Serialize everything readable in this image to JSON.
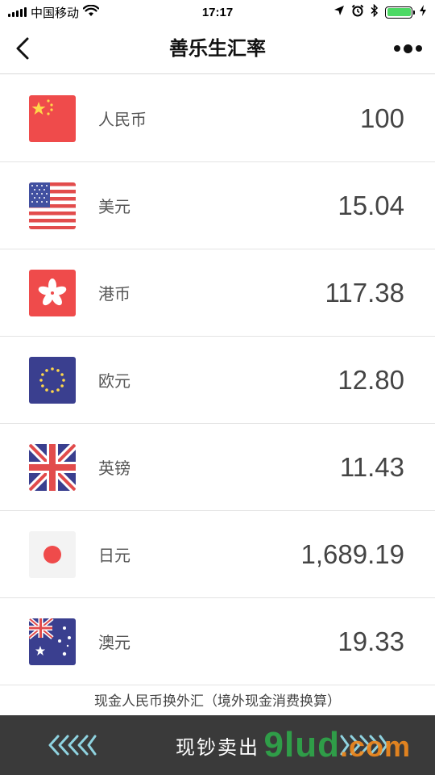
{
  "status_bar": {
    "carrier": "中国移动",
    "time": "17:17",
    "battery_color": "#4cd964",
    "icons": [
      "signal-icon",
      "wifi-icon",
      "location-icon",
      "alarm-icon",
      "bluetooth-icon",
      "battery-icon",
      "charging-icon"
    ]
  },
  "nav": {
    "title": "善乐生汇率",
    "back_icon": "chevron-left-icon",
    "more_icon": "more-dots-icon"
  },
  "currencies": [
    {
      "name": "人民币",
      "amount": "100",
      "flag": "china-flag-icon"
    },
    {
      "name": "美元",
      "amount": "15.04",
      "flag": "usa-flag-icon"
    },
    {
      "name": "港币",
      "amount": "117.38",
      "flag": "hongkong-flag-icon"
    },
    {
      "name": "欧元",
      "amount": "12.80",
      "flag": "eu-flag-icon"
    },
    {
      "name": "英镑",
      "amount": "11.43",
      "flag": "uk-flag-icon"
    },
    {
      "name": "日元",
      "amount": "1,689.19",
      "flag": "japan-flag-icon"
    },
    {
      "name": "澳元",
      "amount": "19.33",
      "flag": "australia-flag-icon"
    }
  ],
  "footer_note": "现金人民币换外汇（境外现金消费换算）",
  "bottom_bar": {
    "label": "现钞卖出",
    "background": "#3a3a3a",
    "arrow_color": "#8fd3e0"
  },
  "watermark": {
    "text": "9lud",
    "suffix": ".com"
  }
}
